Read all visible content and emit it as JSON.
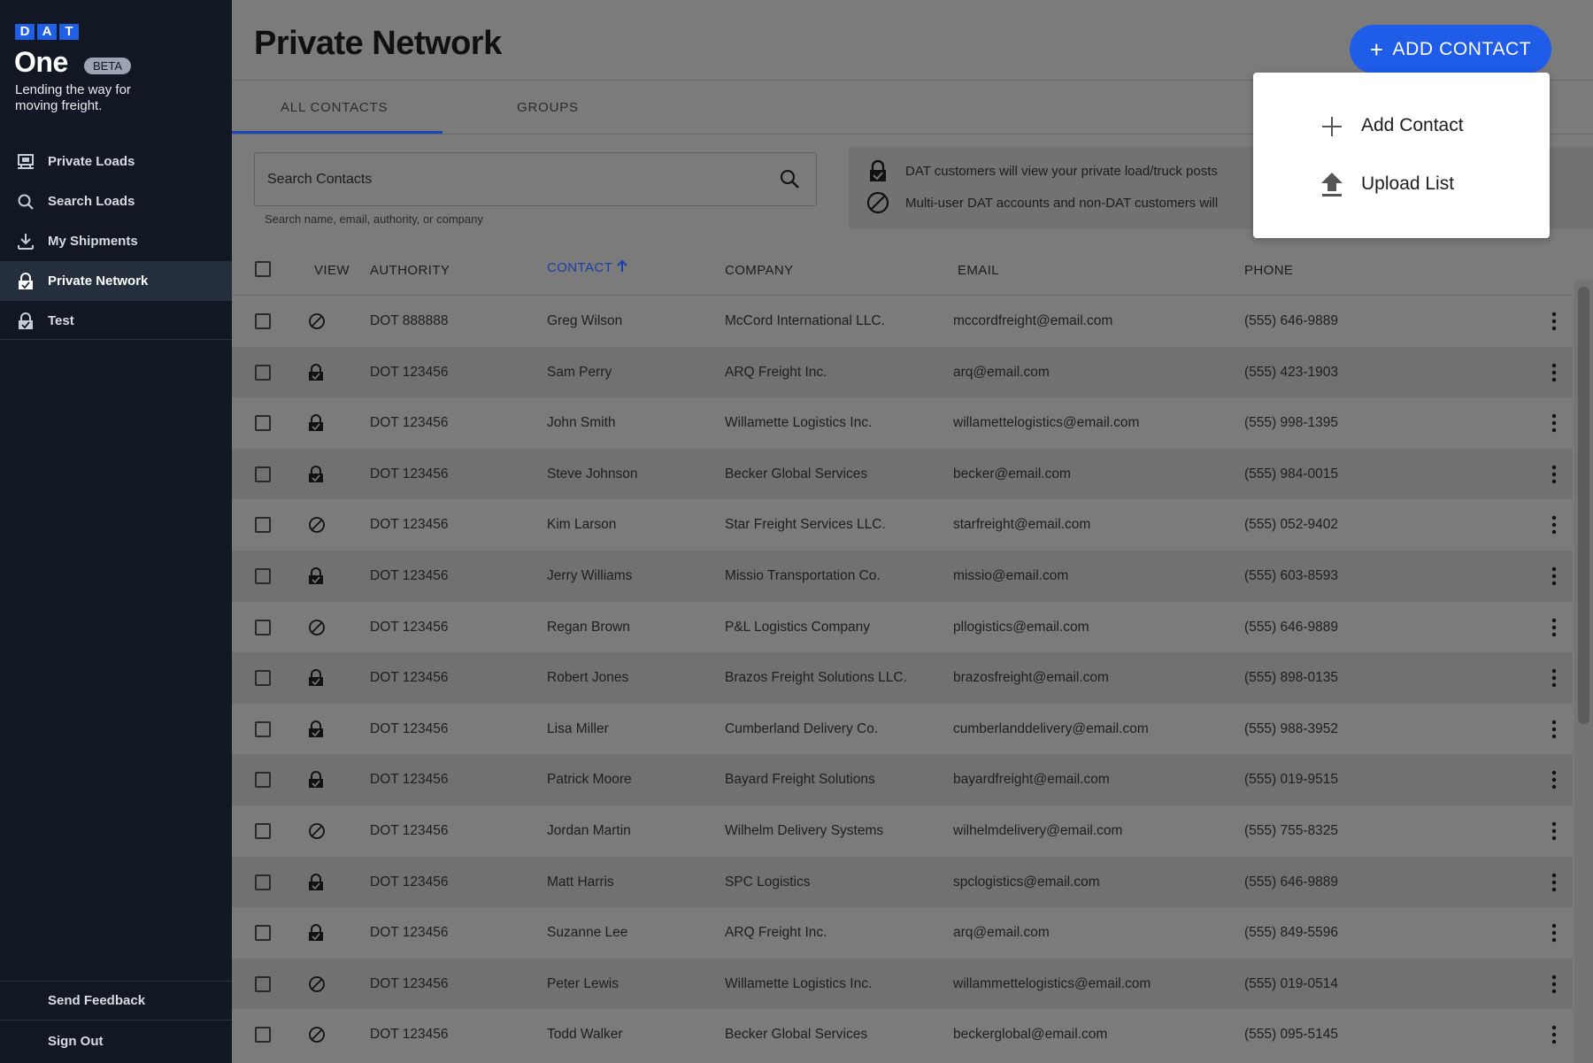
{
  "sidebar": {
    "logo_letters": [
      "D",
      "A",
      "T"
    ],
    "product": "One",
    "badge": "BETA",
    "tagline": "Lending the way for moving freight.",
    "items": [
      {
        "label": "Private Loads",
        "icon": "truck-load-icon"
      },
      {
        "label": "Search Loads",
        "icon": "search-icon"
      },
      {
        "label": "My Shipments",
        "icon": "download-icon"
      },
      {
        "label": "Private Network",
        "icon": "lock-icon",
        "active": true
      },
      {
        "label": "Test",
        "icon": "lock-icon"
      }
    ],
    "send_feedback": "Send Feedback",
    "sign_out": "Sign Out"
  },
  "header": {
    "title": "Private Network",
    "add_button_label": "ADD CONTACT"
  },
  "dropdown": {
    "items": [
      {
        "label": "Add Contact",
        "icon": "plus-icon"
      },
      {
        "label": "Upload List",
        "icon": "upload-icon"
      }
    ]
  },
  "tabs": [
    {
      "label": "ALL CONTACTS",
      "active": true
    },
    {
      "label": "GROUPS",
      "active": false
    }
  ],
  "search": {
    "placeholder": "Search Contacts",
    "help_text": "Search name, email, authority, or company"
  },
  "info": {
    "line1": "DAT customers will view your private load/truck posts",
    "line2": "Multi-user DAT accounts and non-DAT customers will"
  },
  "table": {
    "columns": {
      "view": "VIEW",
      "authority": "AUTHORITY",
      "contact": "CONTACT",
      "company": "COMPANY",
      "email": "EMAIL",
      "phone": "PHONE"
    },
    "rows": [
      {
        "view": "blocked",
        "authority": "DOT 888888",
        "contact": "Greg Wilson",
        "company": "McCord International LLC.",
        "email": "mccordfreight@email.com",
        "phone": "(555) 646-9889"
      },
      {
        "view": "private",
        "authority": "DOT 123456",
        "contact": "Sam Perry",
        "company": "ARQ Freight Inc.",
        "email": "arq@email.com",
        "phone": "(555) 423-1903"
      },
      {
        "view": "private",
        "authority": "DOT 123456",
        "contact": "John Smith",
        "company": "Willamette Logistics Inc.",
        "email": "willamettelogistics@email.com",
        "phone": "(555) 998-1395"
      },
      {
        "view": "private",
        "authority": "DOT 123456",
        "contact": "Steve Johnson",
        "company": "Becker Global Services",
        "email": "becker@email.com",
        "phone": "(555) 984-0015"
      },
      {
        "view": "blocked",
        "authority": "DOT 123456",
        "contact": "Kim Larson",
        "company": "Star Freight Services LLC.",
        "email": "starfreight@email.com",
        "phone": "(555) 052-9402"
      },
      {
        "view": "private",
        "authority": "DOT 123456",
        "contact": "Jerry Williams",
        "company": "Missio Transportation Co.",
        "email": "missio@email.com",
        "phone": "(555) 603-8593"
      },
      {
        "view": "blocked",
        "authority": "DOT 123456",
        "contact": "Regan Brown",
        "company": "P&L Logistics Company",
        "email": "pllogistics@email.com",
        "phone": "(555) 646-9889"
      },
      {
        "view": "private",
        "authority": "DOT 123456",
        "contact": "Robert Jones",
        "company": "Brazos Freight Solutions LLC.",
        "email": "brazosfreight@email.com",
        "phone": "(555) 898-0135"
      },
      {
        "view": "private",
        "authority": "DOT 123456",
        "contact": "Lisa Miller",
        "company": "Cumberland Delivery Co.",
        "email": "cumberlanddelivery@email.com",
        "phone": "(555) 988-3952"
      },
      {
        "view": "private",
        "authority": "DOT 123456",
        "contact": "Patrick Moore",
        "company": "Bayard Freight Solutions",
        "email": "bayardfreight@email.com",
        "phone": "(555) 019-9515"
      },
      {
        "view": "blocked",
        "authority": "DOT 123456",
        "contact": "Jordan Martin",
        "company": "Wilhelm Delivery Systems",
        "email": "wilhelmdelivery@email.com",
        "phone": "(555) 755-8325"
      },
      {
        "view": "private",
        "authority": "DOT 123456",
        "contact": "Matt Harris",
        "company": "SPC Logistics",
        "email": "spclogistics@email.com",
        "phone": "(555) 646-9889"
      },
      {
        "view": "private",
        "authority": "DOT 123456",
        "contact": "Suzanne Lee",
        "company": "ARQ Freight Inc.",
        "email": "arq@email.com",
        "phone": "(555) 849-5596"
      },
      {
        "view": "blocked",
        "authority": "DOT 123456",
        "contact": "Peter Lewis",
        "company": "Willamette Logistics Inc.",
        "email": "willammettelogistics@email.com",
        "phone": "(555) 019-0514"
      },
      {
        "view": "blocked",
        "authority": "DOT 123456",
        "contact": "Todd Walker",
        "company": "Becker Global Services",
        "email": "beckerglobal@email.com",
        "phone": "(555) 095-5145"
      }
    ]
  },
  "colors": {
    "sidebar_bg": "#111823",
    "accent_blue": "#1f5ce8",
    "sorted_header": "#1a3fa8"
  }
}
